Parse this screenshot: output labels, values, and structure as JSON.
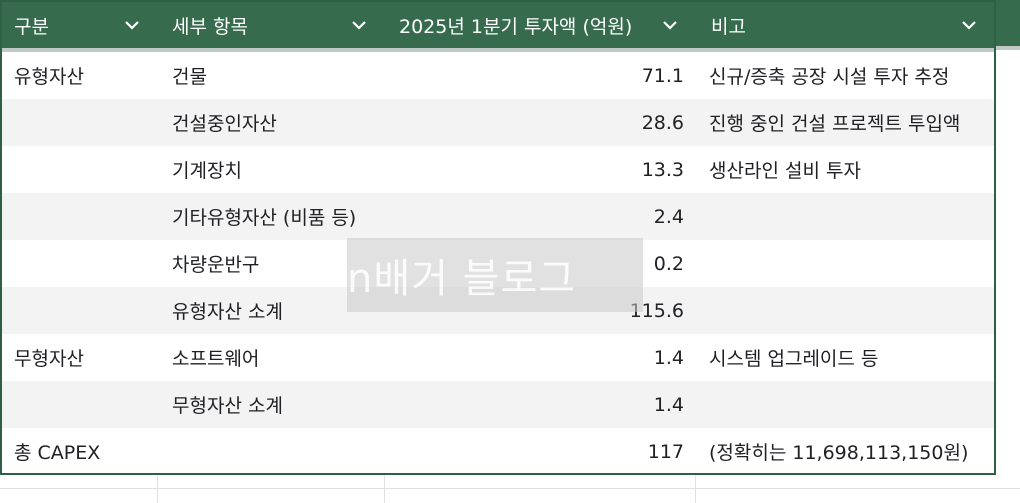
{
  "header": {
    "col1": "구분",
    "col2": "세부 항목",
    "col3": "2025년 1분기 투자액 (억원)",
    "col4": "비고"
  },
  "rows": [
    {
      "category": "유형자산",
      "item": "건물",
      "amount": "71.1",
      "note": "신규/증축 공장 시설 투자 추정"
    },
    {
      "category": "",
      "item": "건설중인자산",
      "amount": "28.6",
      "note": "진행 중인 건설 프로젝트 투입액"
    },
    {
      "category": "",
      "item": "기계장치",
      "amount": "13.3",
      "note": "생산라인 설비 투자"
    },
    {
      "category": "",
      "item": "기타유형자산 (비품 등)",
      "amount": "2.4",
      "note": ""
    },
    {
      "category": "",
      "item": "차량운반구",
      "amount": "0.2",
      "note": ""
    },
    {
      "category": "",
      "item": "유형자산 소계",
      "amount": "115.6",
      "note": ""
    },
    {
      "category": "무형자산",
      "item": "소프트웨어",
      "amount": "1.4",
      "note": "시스템 업그레이드 등"
    },
    {
      "category": "",
      "item": "무형자산 소계",
      "amount": "1.4",
      "note": ""
    },
    {
      "category": "총 CAPEX",
      "item": "",
      "amount": "117",
      "note": "(정확히는 11,698,113,150원)"
    }
  ],
  "watermark": "n배거 블로그",
  "colors": {
    "header_bg": "#376b4e",
    "band": "#f3f3f3",
    "border": "#2f5f46"
  },
  "icons": [
    "chevron-down-icon"
  ]
}
